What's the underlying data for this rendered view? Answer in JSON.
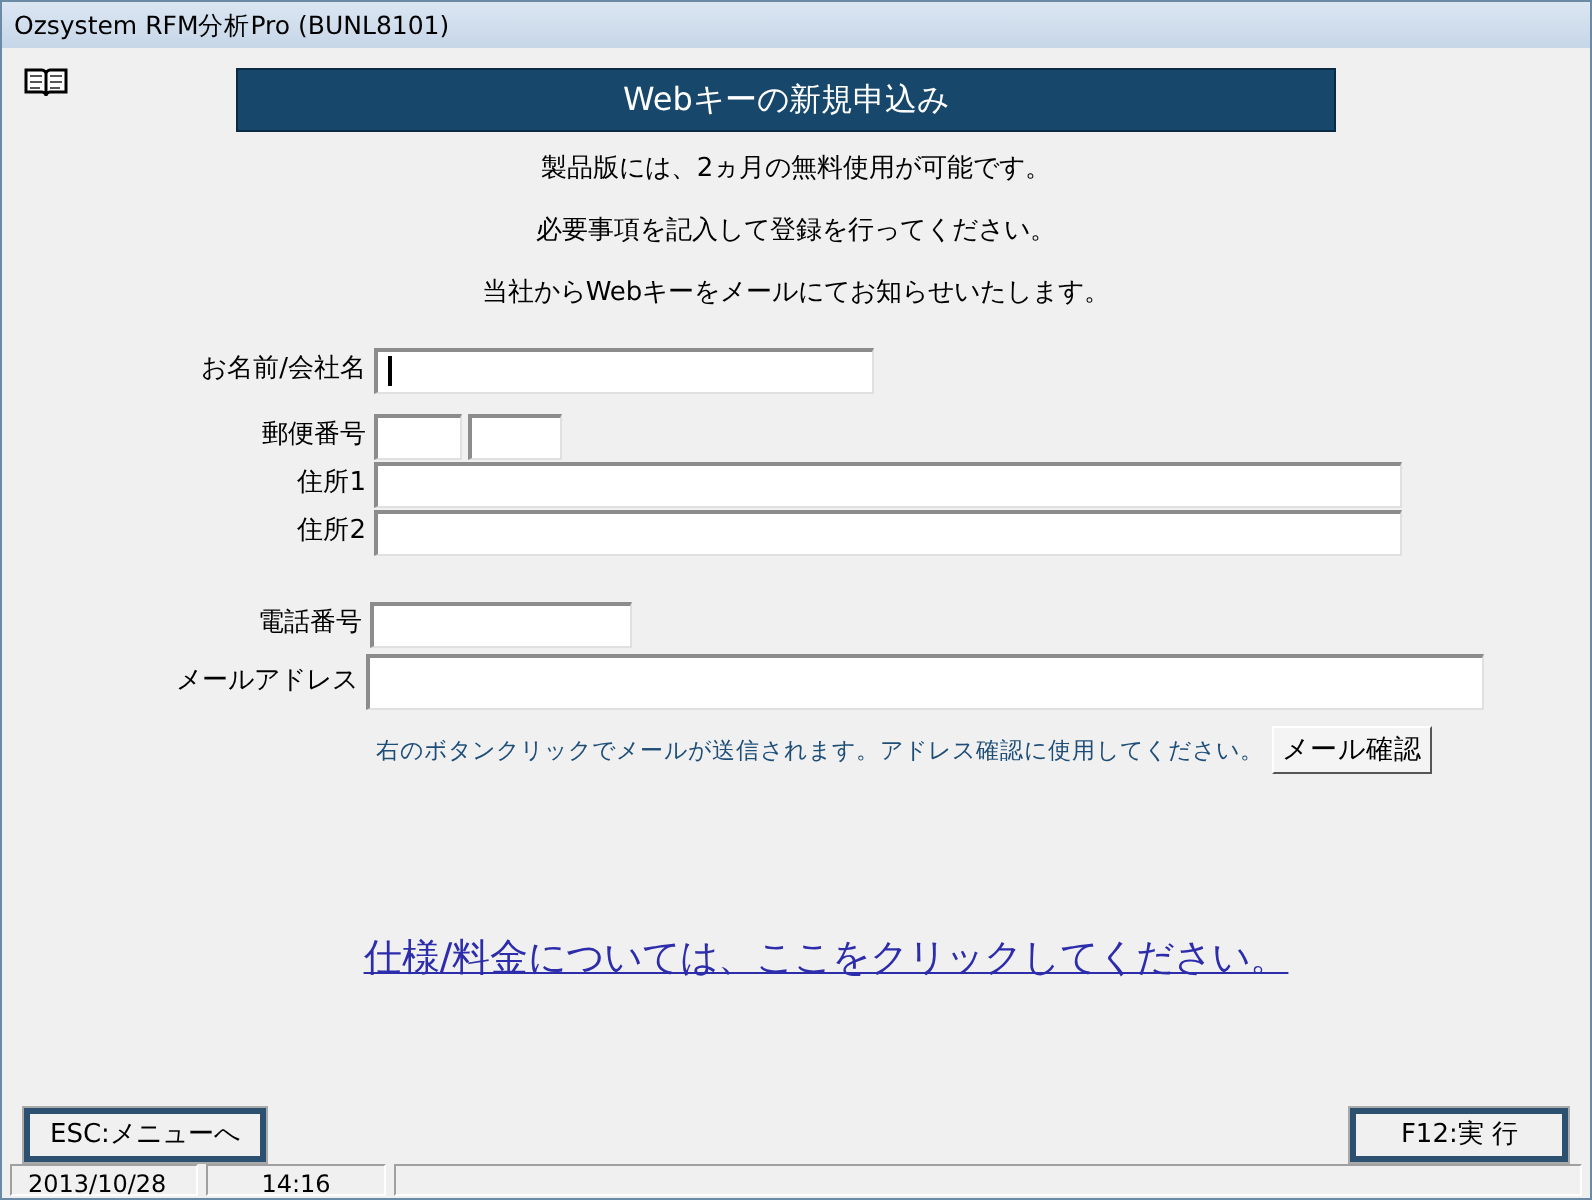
{
  "window": {
    "title": "Ozsystem RFM分析Pro (BUNL8101)"
  },
  "heading": "Webキーの新規申込み",
  "intro": [
    "製品版には、2ヵ月の無料使用が可能です。",
    "必要事項を記入して登録を行ってください。",
    "当社からWebキーをメールにてお知らせいたします。"
  ],
  "fields": [
    {
      "kind": "name",
      "label": "お名前/会社名",
      "focused": true
    },
    {
      "kind": "zip",
      "label": "郵便番号"
    },
    {
      "kind": "address",
      "label": "住所1",
      "focused": false
    },
    {
      "kind": "address",
      "label": "住所2",
      "focused": false
    },
    {
      "kind": "gap"
    },
    {
      "kind": "phone",
      "label": "電話番号",
      "focused": false
    },
    {
      "kind": "email",
      "label": "メールアドレス",
      "focused": false
    }
  ],
  "mail_note": "右のボタンクリックでメールが送信されます。アドレス確認に使用してください。",
  "mail_button": "メール確認",
  "pricing_link": "仕様/料金については、ここをクリックしてください。",
  "buttons": {
    "left": "ESC:メニューへ",
    "right": "F12:実 行"
  },
  "status_bar": [
    "2013/10/28",
    "14:16"
  ]
}
